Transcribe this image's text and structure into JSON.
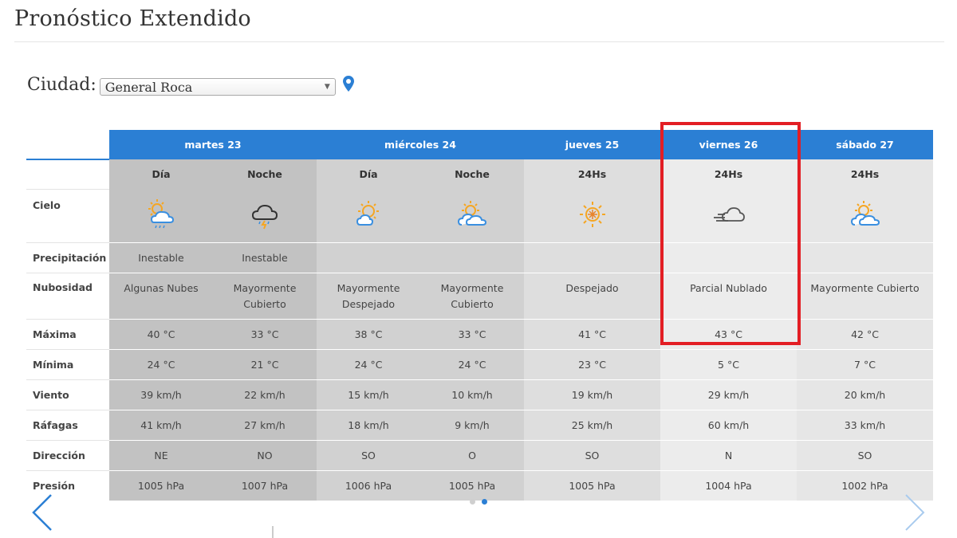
{
  "page_title": "Pronóstico Extendido",
  "city": {
    "label": "Ciudad:",
    "selected": "General Roca"
  },
  "days": [
    {
      "label": "martes 23"
    },
    {
      "label": "miércoles 24"
    },
    {
      "label": "jueves 25"
    },
    {
      "label": "viernes 26"
    },
    {
      "label": "sábado 27"
    }
  ],
  "periods": [
    "Día",
    "Noche",
    "Día",
    "Noche",
    "24Hs",
    "24Hs",
    "24Hs"
  ],
  "row_labels": {
    "sky": "Cielo",
    "precip": "Precipitación",
    "cloud": "Nubosidad",
    "max": "Máxima",
    "min": "Mínima",
    "wind": "Viento",
    "gust": "Ráfagas",
    "dir": "Dirección",
    "pressure": "Presión"
  },
  "sky_icons": [
    "sun-cloud-rain-icon",
    "cloud-storm-icon",
    "sun-cloud-icon",
    "sun-clouds-icon",
    "sun-icon",
    "cloud-fog-icon",
    "sun-clouds-icon"
  ],
  "precip": [
    "Inestable",
    "Inestable",
    "",
    "",
    "",
    "",
    ""
  ],
  "cloud": [
    [
      "Algunas Nubes"
    ],
    [
      "Mayormente",
      "Cubierto"
    ],
    [
      "Mayormente",
      "Despejado"
    ],
    [
      "Mayormente",
      "Cubierto"
    ],
    [
      "Despejado"
    ],
    [
      "Parcial Nublado"
    ],
    [
      "Mayormente Cubierto"
    ]
  ],
  "max": [
    "40 °C",
    "33 °C",
    "38 °C",
    "33 °C",
    "41 °C",
    "43 °C",
    "42 °C"
  ],
  "min": [
    "24 °C",
    "21 °C",
    "24 °C",
    "24 °C",
    "23 °C",
    "5 °C",
    "7 °C"
  ],
  "wind": [
    "39 km/h",
    "22 km/h",
    "15 km/h",
    "10 km/h",
    "19 km/h",
    "29 km/h",
    "20 km/h"
  ],
  "gust": [
    "41 km/h",
    "27 km/h",
    "18 km/h",
    "9 km/h",
    "25 km/h",
    "60 km/h",
    "33 km/h"
  ],
  "dir": [
    "NE",
    "NO",
    "SO",
    "O",
    "SO",
    "N",
    "SO"
  ],
  "pressure": [
    "1005 hPa",
    "1007 hPa",
    "1006 hPa",
    "1005 hPa",
    "1005 hPa",
    "1004 hPa",
    "1002 hPa"
  ],
  "pagination": {
    "pages": 2,
    "active": 2
  },
  "colors": {
    "accent": "#2b7fd4",
    "highlight": "#e31e24"
  }
}
